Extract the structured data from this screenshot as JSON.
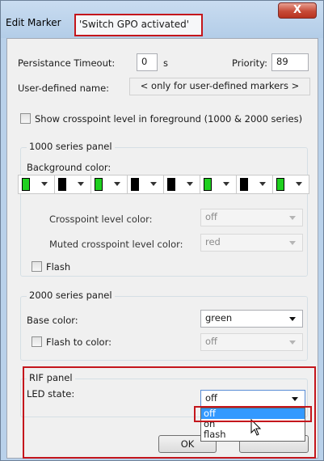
{
  "window": {
    "title_prefix": "Edit Marker",
    "title_name": "'Switch GPO  activated'",
    "close_glyph": "X"
  },
  "general": {
    "persistance_label": "Persistance Timeout:",
    "persistance_value": "0",
    "persistance_unit": "s",
    "priority_label": "Priority:",
    "priority_value": "89",
    "user_name_label": "User-defined name:",
    "user_name_placeholder": "< only for user-defined markers >",
    "show_crosspoint_label": "Show crosspoint level in foreground (1000 & 2000 series)"
  },
  "panel1000": {
    "title": "1000 series panel",
    "bg_color_label": "Background color:",
    "swatches": [
      "#1fd01f",
      "#000000",
      "#1fd01f",
      "#000000",
      "#000000",
      "#1fd01f",
      "#000000",
      "#1fd01f"
    ],
    "crosspoint_label": "Crosspoint level color:",
    "crosspoint_value": "off",
    "muted_label": "Muted crosspoint level color:",
    "muted_value": "red",
    "flash_label": "Flash"
  },
  "panel2000": {
    "title": "2000 series panel",
    "base_color_label": "Base color:",
    "base_color_value": "green",
    "flash_to_label": "Flash to color:",
    "flash_to_value": "off"
  },
  "rif": {
    "title": "RIF panel",
    "led_label": "LED state:",
    "led_value": "off",
    "options": [
      "off",
      "on",
      "flash"
    ]
  },
  "buttons": {
    "ok": "OK"
  },
  "colors": {
    "highlight_red": "#c4161c",
    "selection_blue": "#3399ff",
    "swatch_green": "#1fd01f"
  }
}
